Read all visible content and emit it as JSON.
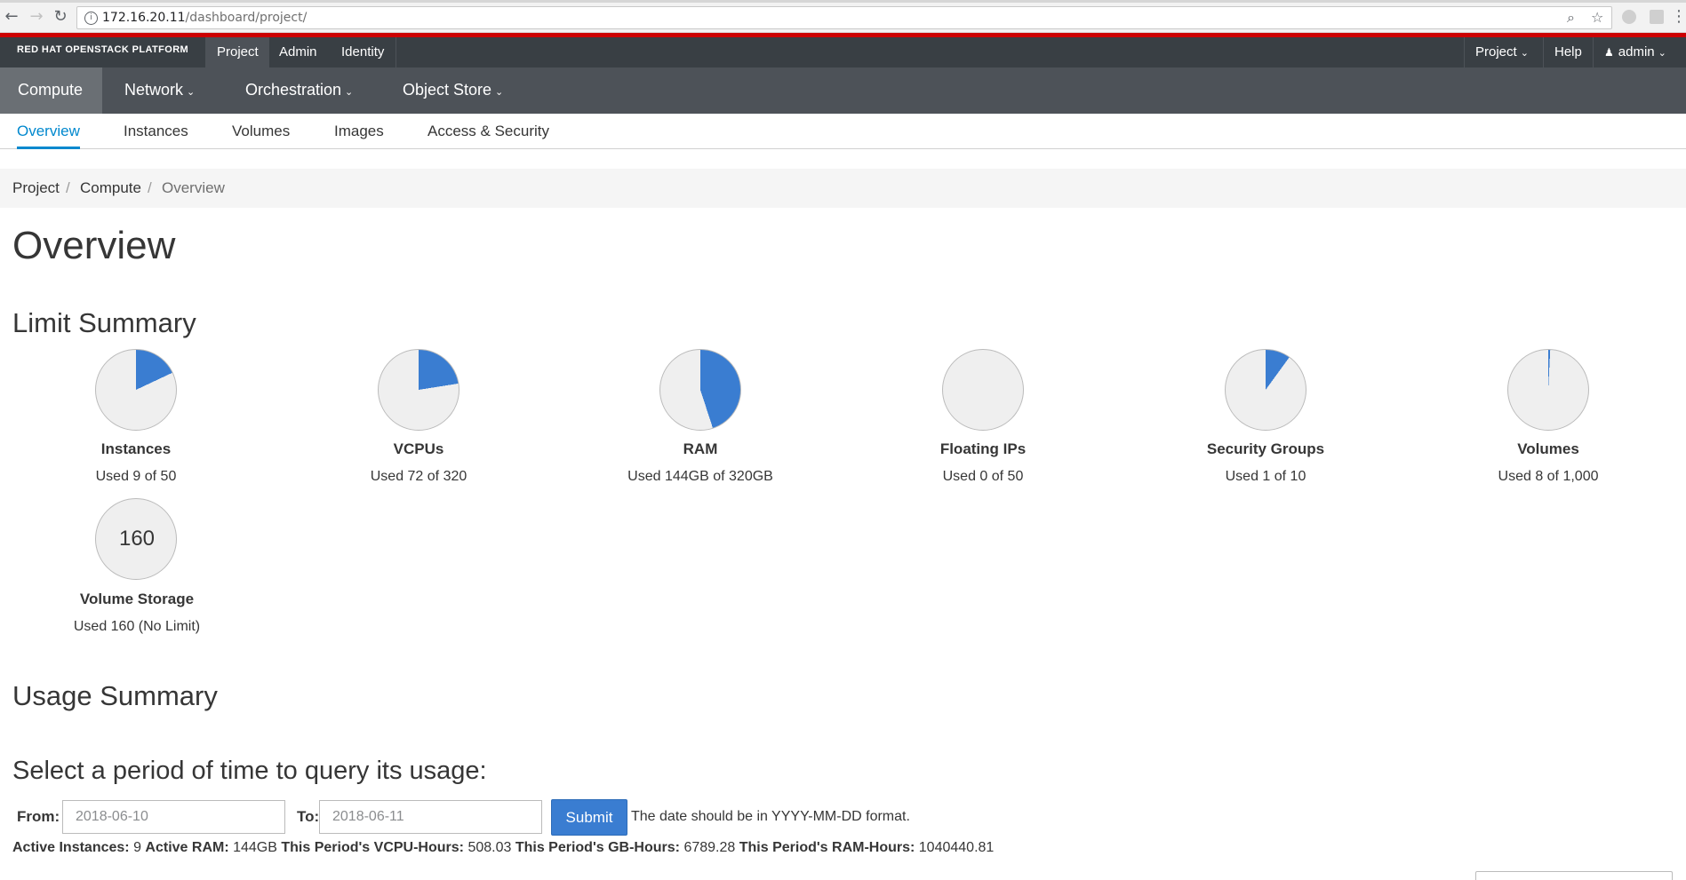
{
  "browser": {
    "url_host": "172.16.20.11",
    "url_path": "/dashboard/project/"
  },
  "topbar": {
    "brand": "RED HAT OPENSTACK PLATFORM",
    "nav": [
      "Project",
      "Admin",
      "Identity"
    ],
    "right": {
      "project_menu": "Project",
      "help": "Help",
      "user": "admin"
    }
  },
  "compute_nav": [
    "Compute",
    "Network",
    "Orchestration",
    "Object Store"
  ],
  "sub_nav": [
    "Overview",
    "Instances",
    "Volumes",
    "Images",
    "Access & Security"
  ],
  "breadcrumb": [
    "Project",
    "Compute",
    "Overview"
  ],
  "page_title": "Overview",
  "limit_summary": {
    "heading": "Limit Summary",
    "items": [
      {
        "label": "Instances",
        "usage": "Used 9 of 50",
        "used": 9,
        "total": 50
      },
      {
        "label": "VCPUs",
        "usage": "Used 72 of 320",
        "used": 72,
        "total": 320
      },
      {
        "label": "RAM",
        "usage": "Used 144GB of 320GB",
        "used": 144,
        "total": 320
      },
      {
        "label": "Floating IPs",
        "usage": "Used 0 of 50",
        "used": 0,
        "total": 50
      },
      {
        "label": "Security Groups",
        "usage": "Used 1 of 10",
        "used": 1,
        "total": 10
      },
      {
        "label": "Volumes",
        "usage": "Used 8 of 1,000",
        "used": 8,
        "total": 1000
      }
    ],
    "storage": {
      "value": "160",
      "label": "Volume Storage",
      "usage": "Used 160 (No Limit)"
    }
  },
  "usage_summary": {
    "heading": "Usage Summary",
    "query_heading": "Select a period of time to query its usage:",
    "from_label": "From:",
    "from_value": "2018-06-10",
    "to_label": "To:",
    "to_value": "2018-06-11",
    "submit": "Submit",
    "hint": "The date should be in YYYY-MM-DD format.",
    "stats": {
      "active_instances_label": "Active Instances:",
      "active_instances": "9",
      "active_ram_label": "Active RAM:",
      "active_ram": "144GB",
      "vcpu_hours_label": "This Period's VCPU-Hours:",
      "vcpu_hours": "508.03",
      "gb_hours_label": "This Period's GB-Hours:",
      "gb_hours": "6789.28",
      "ram_hours_label": "This Period's RAM-Hours:",
      "ram_hours": "1040440.81"
    }
  },
  "colors": {
    "pie_used": "#3a7dd1",
    "pie_free": "#efefef",
    "accent": "#0088ce",
    "topbar": "#393f44",
    "redline": "#cc0000"
  }
}
